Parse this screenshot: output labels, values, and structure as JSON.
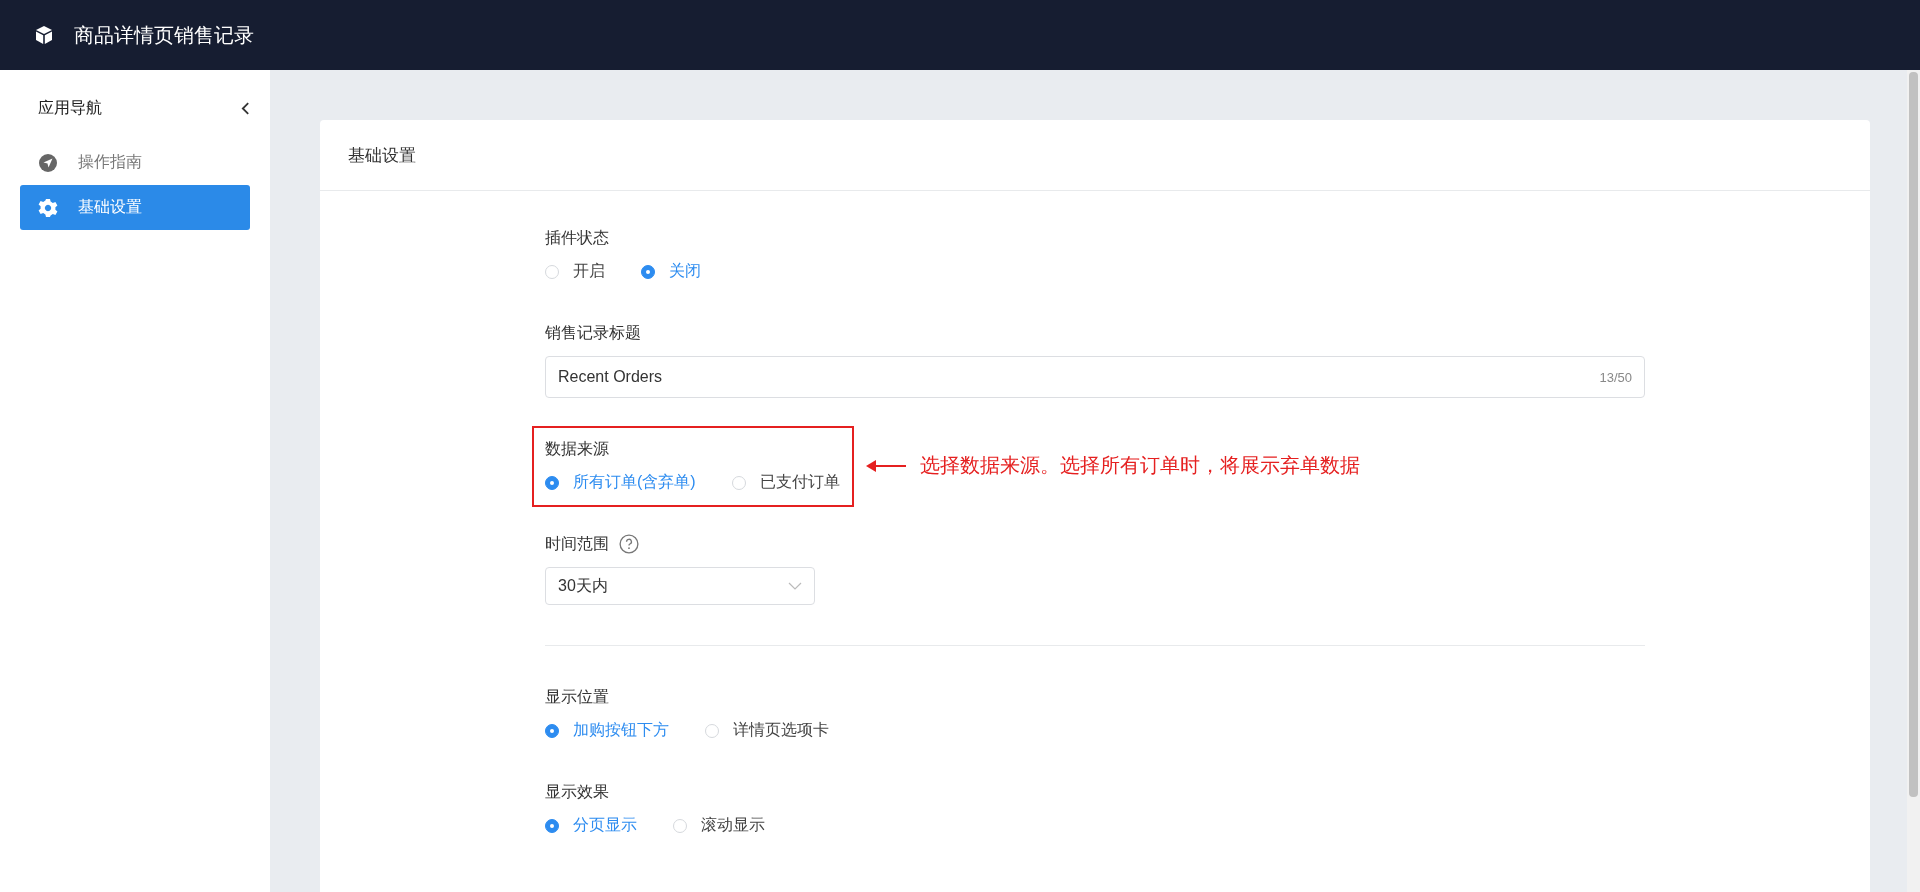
{
  "header": {
    "title": "商品详情页销售记录"
  },
  "sidebar": {
    "title": "应用导航",
    "items": [
      {
        "label": "操作指南",
        "kind": "guide",
        "selected": false
      },
      {
        "label": "基础设置",
        "kind": "settings",
        "selected": true
      }
    ]
  },
  "card": {
    "title": "基础设置"
  },
  "fields": [
    {
      "kind": "radio",
      "label": "插件状态",
      "options": [
        {
          "label": "开启",
          "selected": false
        },
        {
          "label": "关闭",
          "selected": true
        }
      ]
    },
    {
      "kind": "text",
      "label": "销售记录标题",
      "value": "Recent Orders",
      "counter": "13/50"
    },
    {
      "kind": "radio",
      "label": "数据来源",
      "options": [
        {
          "label": "所有订单(含弃单)",
          "selected": true
        },
        {
          "label": "已支付订单",
          "selected": false
        }
      ],
      "annotation": "选择数据来源。选择所有订单时，将展示弃单数据"
    },
    {
      "kind": "select",
      "label": "时间范围",
      "help": true,
      "value": "30天内"
    },
    {
      "kind": "divider"
    },
    {
      "kind": "radio",
      "label": "显示位置",
      "options": [
        {
          "label": "加购按钮下方",
          "selected": true
        },
        {
          "label": "详情页选项卡",
          "selected": false
        }
      ]
    },
    {
      "kind": "radio",
      "label": "显示效果",
      "options": [
        {
          "label": "分页显示",
          "selected": true
        },
        {
          "label": "滚动显示",
          "selected": false
        }
      ]
    }
  ]
}
